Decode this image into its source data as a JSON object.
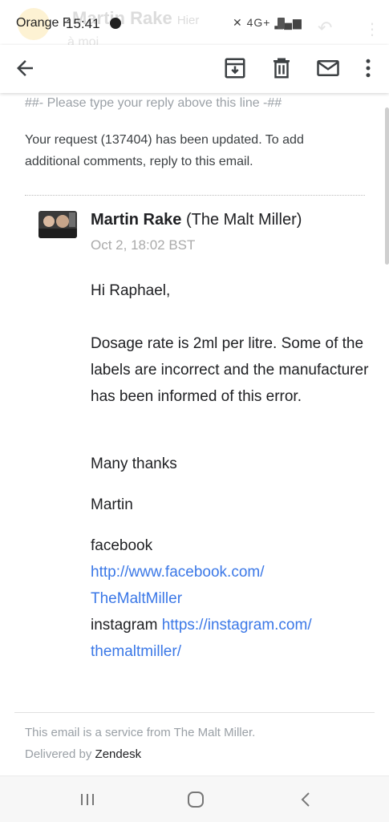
{
  "status_bar": {
    "carrier": "Orange F",
    "time": "15:41",
    "network": "4G+",
    "behind_sender": "Martin Rake",
    "behind_when": "Hier",
    "behind_to": "à moi"
  },
  "toolbar": {
    "back_icon": "arrow-left-icon",
    "archive_icon": "archive-icon",
    "delete_icon": "trash-icon",
    "mail_icon": "envelope-icon",
    "more_icon": "more-vertical-icon"
  },
  "email": {
    "reply_line": "##- Please type your reply above this line -##",
    "update_text": "Your request (137404) has been updated. To add additional comments, reply to this email.",
    "sender_name": "Martin Rake",
    "sender_org": "(The Malt Miller)",
    "date": "Oct 2, 18:02 BST",
    "greeting": "Hi Raphael,",
    "paragraph": "Dosage rate is 2ml per litre. Some of the labels are incorrect and the manufacturer has been informed of this error.",
    "thanks": "Many thanks",
    "signature": "Martin",
    "facebook_label": "facebook",
    "facebook_link_1": "http://www.facebook.com/",
    "facebook_link_2": "TheMaltMiller",
    "instagram_label": "instagram",
    "instagram_link_1": "https://instagram.com/",
    "instagram_link_2": "themaltmiller/"
  },
  "footer": {
    "service_text": "This email is a service from The Malt Miller.",
    "delivered_by": "Delivered by",
    "brand": "Zendesk"
  },
  "nav": {
    "recent_icon": "recent-apps-icon",
    "home_icon": "home-icon",
    "back_icon": "nav-back-icon"
  },
  "colors": {
    "link": "#3b78e7",
    "muted": "#9aa0a6",
    "text": "#202124"
  }
}
